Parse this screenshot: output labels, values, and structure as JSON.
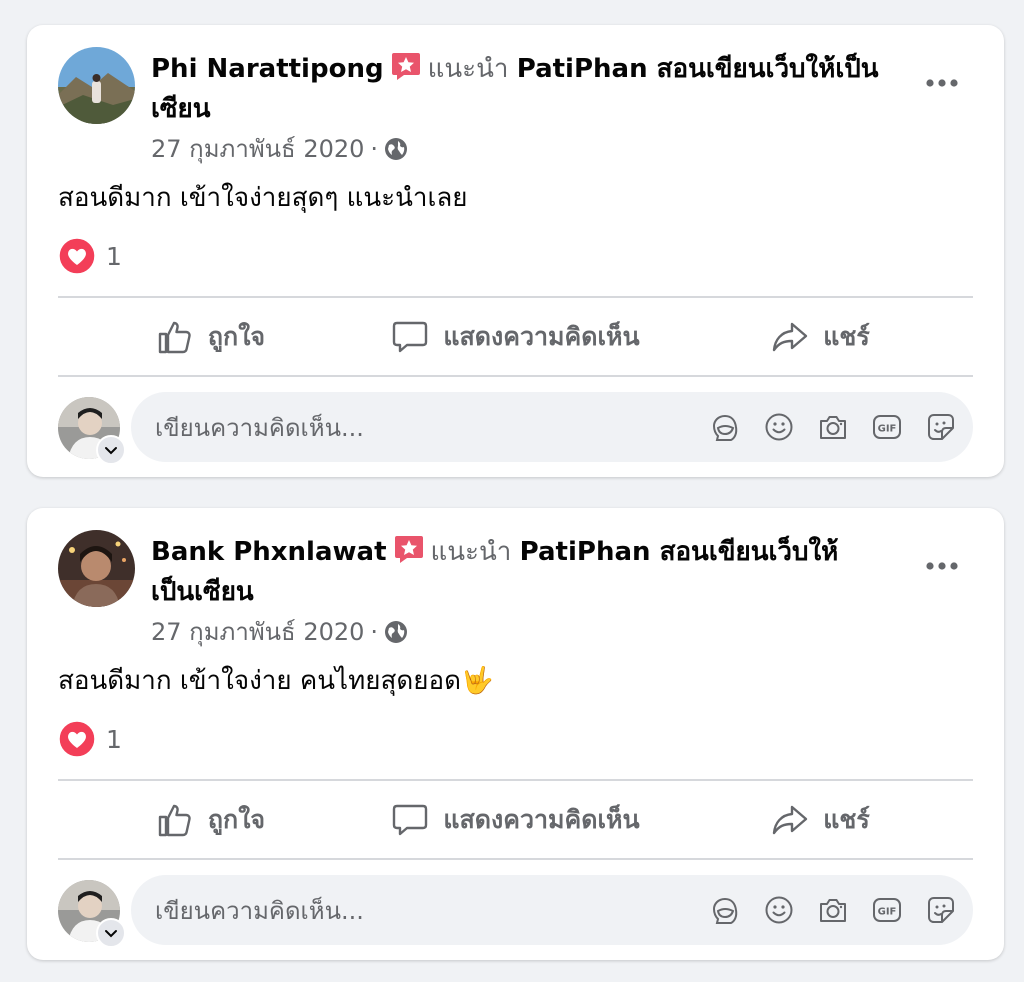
{
  "posts": [
    {
      "author": "Phi Narattipong",
      "verb": "แนะนำ",
      "page_name": "PatiPhan สอนเขียนเว็บให้เป็นเซียน",
      "date": "27 กุมภาพันธ์ 2020",
      "separator": "·",
      "text": "สอนดีมาก เข้าใจง่ายสุดๆ แนะนำเลย",
      "reaction_count": "1"
    },
    {
      "author": "Bank Phxnlawat",
      "verb": "แนะนำ",
      "page_name": "PatiPhan สอนเขียนเว็บให้เป็นเซียน",
      "date": "27 กุมภาพันธ์ 2020",
      "separator": "·",
      "text": "สอนดีมาก เข้าใจง่าย คนไทยสุดยอด🤟",
      "reaction_count": "1"
    }
  ],
  "actions": {
    "like": "ถูกใจ",
    "comment": "แสดงความคิดเห็น",
    "share": "แชร์"
  },
  "comment_placeholder": "เขียนความคิดเห็น...",
  "icons": {
    "badge": "recommend-star-badge-icon",
    "privacy": "globe-icon",
    "more": "more-options-icon",
    "reaction": "love-reaction-icon",
    "like": "thumbs-up-icon",
    "comment": "comment-bubble-icon",
    "share": "share-arrow-icon",
    "avatar_sticker": "avatar-sticker-icon",
    "emoji": "emoji-icon",
    "camera": "camera-icon",
    "gif": "gif-icon",
    "sticker": "sticker-icon"
  },
  "colors": {
    "background": "#f0f2f5",
    "card": "#ffffff",
    "secondary_text": "#65676b",
    "badge_red": "#e9546b",
    "heart_red": "#f33e58"
  }
}
